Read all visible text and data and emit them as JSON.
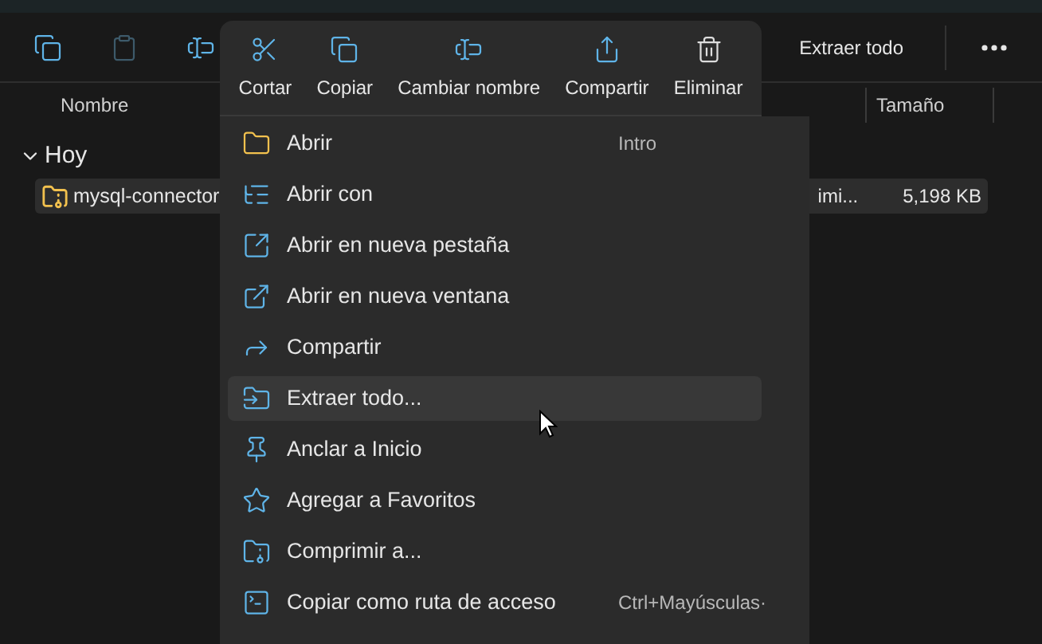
{
  "toolbar": {
    "icon_buttons": [
      {
        "disabled": false
      },
      {
        "disabled": true
      },
      {
        "disabled": false
      }
    ],
    "extract_button": "Extraer todo"
  },
  "table": {
    "columns": [
      "Nombre",
      "Tamaño"
    ],
    "groups": [
      {
        "label": "Hoy",
        "expanded": true,
        "rows": [
          {
            "name": "mysql-connector",
            "column_2": "imi...",
            "size": "5,198 KB",
            "selected": true
          }
        ]
      }
    ]
  },
  "context_menu": {
    "quick_actions": [
      "Cortar",
      "Copiar",
      "Cambiar nombre",
      "Compartir",
      "Eliminar"
    ],
    "items": [
      {
        "label": "Abrir",
        "shortcut": "Intro",
        "selected": false
      },
      {
        "label": "Abrir con",
        "selected": false
      },
      {
        "label": "Abrir en nueva pestaña",
        "selected": false
      },
      {
        "label": "Abrir en nueva ventana",
        "selected": false
      },
      {
        "label": "Compartir",
        "selected": false
      },
      {
        "label": "Extraer todo...",
        "selected": true
      },
      {
        "label": "Anclar a Inicio",
        "selected": false
      },
      {
        "label": "Agregar a Favoritos",
        "selected": false
      },
      {
        "label": "Comprimir a...",
        "selected": false
      },
      {
        "label": "Copiar como ruta de acceso",
        "shortcut": "Ctrl+Mayúsculas·",
        "selected": false
      }
    ]
  }
}
